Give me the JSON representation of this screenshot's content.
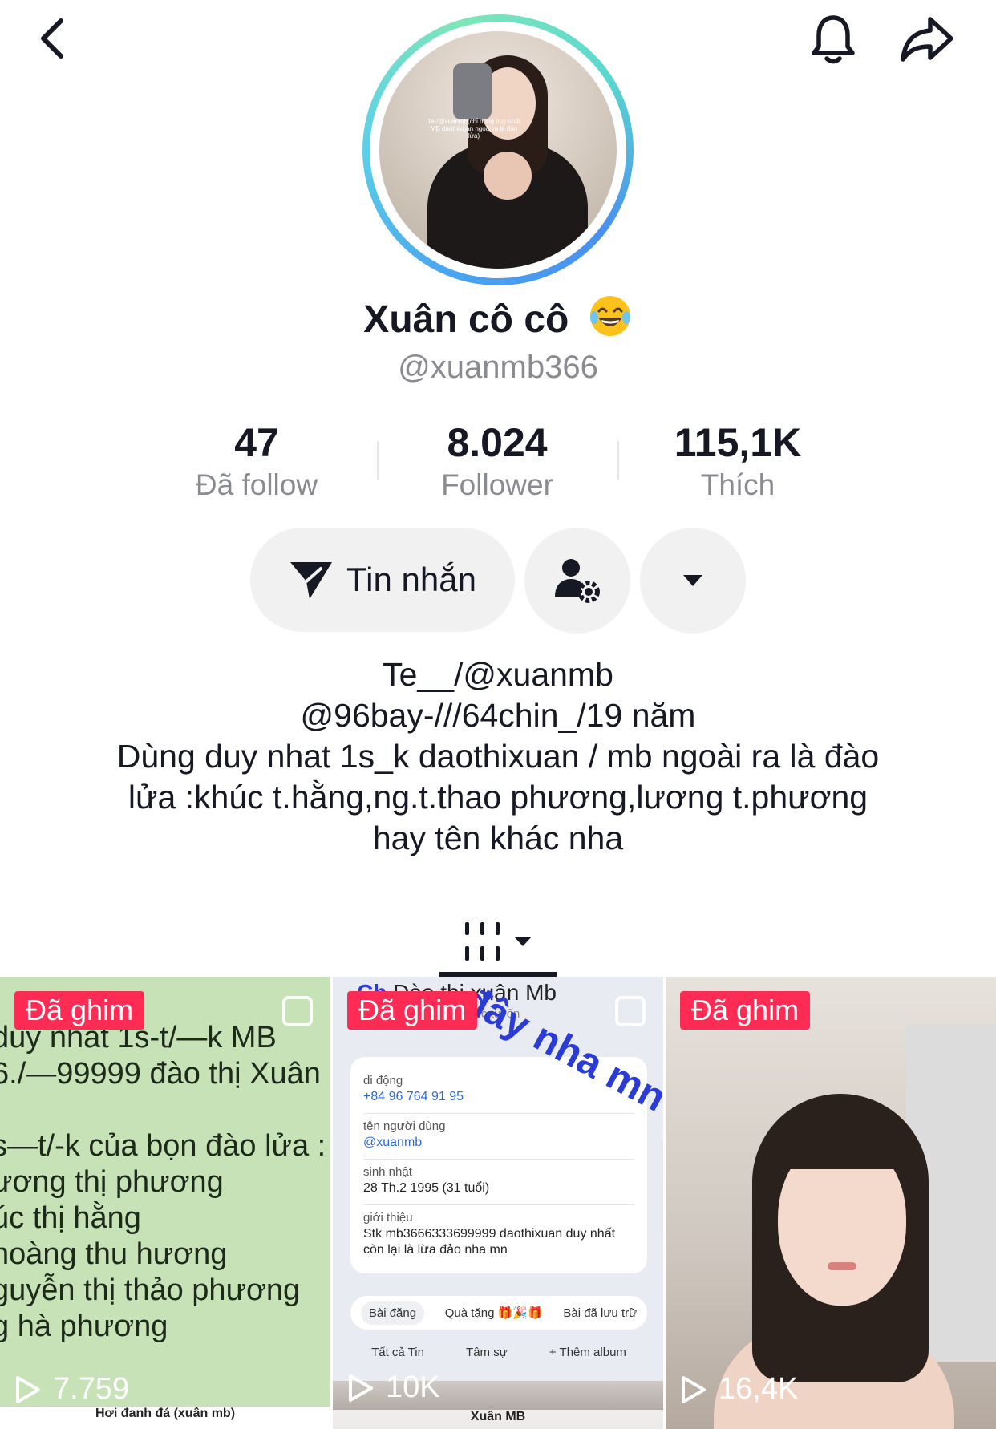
{
  "profile": {
    "name": "Xuân cô cô",
    "handle": "@xuanmb366",
    "avatar_watermark": "Te-/@xuanmb(chỉ dùng duy nhất MB daothixuan ngoài ra là đảo lửa)"
  },
  "stats": [
    {
      "value": "47",
      "label": "Đã follow"
    },
    {
      "value": "8.024",
      "label": "Follower"
    },
    {
      "value": "115,1K",
      "label": "Thích"
    }
  ],
  "actions": {
    "message_label": "Tin nhắn"
  },
  "bio": {
    "lines": [
      "Te__/@xuanmb",
      "@96bay-///64chin_/19 năm",
      "Dùng duy nhat 1s_k daothixuan / mb ngoài ra là đào",
      "lửa :khúc t.hằng,ng.t.thao phương,lương t.phương",
      "hay tên khác nha"
    ]
  },
  "videos": [
    {
      "pinned_label": "Đã ghim",
      "views": "7.759",
      "text_lines": [
        "duy nhat 1s-t/—k MB",
        "6./—99999 đào thị Xuân",
        "",
        "s—t/-k của bọn đào lửa :",
        "ương thị phương",
        "úc thị hằng",
        "hoàng thu hương",
        "guyễn thị thảo phương",
        "g hà phương"
      ],
      "caption": "Hơi đanh đá (xuân mb)"
    },
    {
      "pinned_label": "Đã ghim",
      "views": "10K",
      "top_title": "Đào thị xuân Mb",
      "top_sub": "ực tuyến",
      "overlay_text": "đây nha mn",
      "top_partial": "Ch",
      "card": {
        "phone_label": "di động",
        "phone_value": "+84 96 764 91 95",
        "user_label": "tên người dùng",
        "user_value": "@xuanmb",
        "birthday_label": "sinh nhật",
        "birthday_value": "28 Th.2 1995 (31 tuổi)",
        "intro_label": "giới thiệu",
        "intro_value_1": "Stk mb3666333699999 daothixuan duy nhất",
        "intro_value_2": "còn lại là lừa đảo nha mn"
      },
      "pills": [
        "Bài đăng",
        "Quà tặng 🎁🎉🎁",
        "Bài đã lưu trữ"
      ],
      "subtabs": [
        "Tất cả Tin",
        "Tâm sự",
        "+ Thêm album"
      ],
      "caption": "Xuân MB"
    },
    {
      "pinned_label": "Đã ghim",
      "views": "16,4K"
    }
  ],
  "colors": {
    "accent": "#fe2c55",
    "text": "#161823",
    "muted": "#8a8b91",
    "button_bg": "#f1f1f2"
  },
  "icons": {
    "back": "chevron-left-icon",
    "bell": "bell-icon",
    "share": "share-arrow-icon",
    "message": "send-icon",
    "friend_settings": "user-gear-icon",
    "more": "caret-down-icon",
    "grid_tab": "grid-bars-icon",
    "play": "play-outline-icon"
  }
}
